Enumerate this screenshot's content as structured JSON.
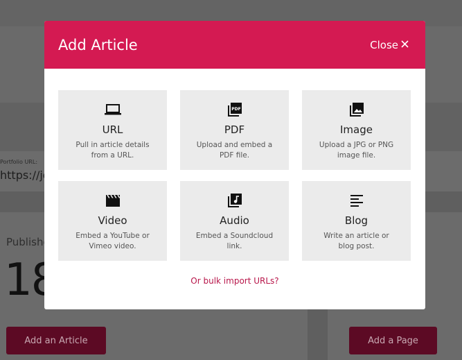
{
  "background": {
    "portfolio_label": "Portfolio URL:",
    "portfolio_url": "https://jo",
    "published_label": "Publishe",
    "published_count": "18",
    "add_article_button": "Add an Article",
    "add_page_button": "Add a Page"
  },
  "modal": {
    "title": "Add Article",
    "close_label": "Close",
    "close_icon": "close-icon",
    "options": [
      {
        "icon": "laptop-icon",
        "title": "URL",
        "description": "Pull in article details from a URL."
      },
      {
        "icon": "pdf-icon",
        "title": "PDF",
        "description": "Upload and embed a PDF file."
      },
      {
        "icon": "image-icon",
        "title": "Image",
        "description": "Upload a JPG or PNG image file."
      },
      {
        "icon": "video-icon",
        "title": "Video",
        "description": "Embed a YouTube or Vimeo video."
      },
      {
        "icon": "audio-icon",
        "title": "Audio",
        "description": "Embed a Soundcloud link."
      },
      {
        "icon": "blog-icon",
        "title": "Blog",
        "description": "Write an article or blog post."
      }
    ],
    "bulk_import_link": "Or bulk import URLs?"
  },
  "colors": {
    "accent": "#d41a52",
    "link": "#b8164a",
    "tile_bg": "#ebebeb",
    "overlay_button": "#5c0a24"
  }
}
